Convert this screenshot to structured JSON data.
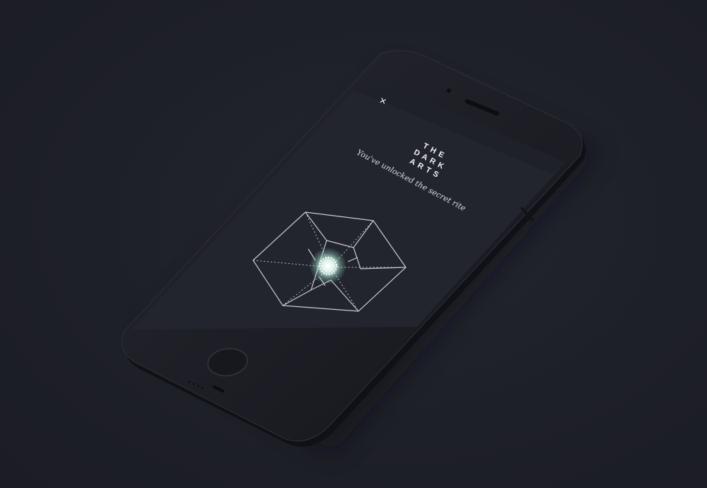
{
  "app": {
    "title_lines": [
      "T H E",
      "D A R K",
      "A R T S"
    ],
    "subtitle": "You've unlocked the secret rite",
    "close_glyph": "×"
  },
  "icons": {
    "close": "close-icon",
    "emblem": "glowing-sigil-icon",
    "home": "home-button"
  },
  "colors": {
    "background": "#1d1f27",
    "phone_body": "#16171d",
    "screen": "#23252e",
    "line_art": "#c9cbd2",
    "glow": "#dff8f0",
    "text": "#f2f2f2"
  }
}
